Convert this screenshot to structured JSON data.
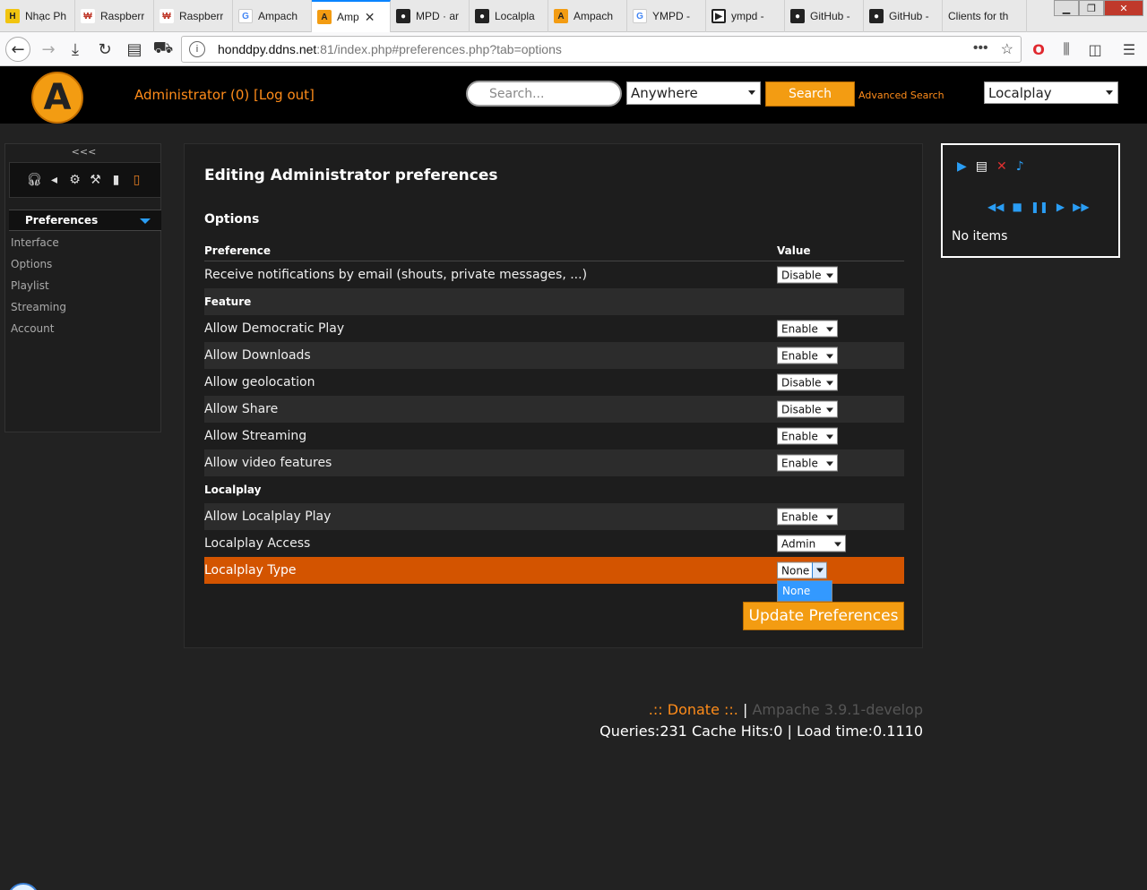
{
  "browser": {
    "tabs": [
      {
        "label": "Nhạc Ph",
        "favicon": "nhac-icon",
        "icon_text": "H"
      },
      {
        "label": "Raspberr",
        "favicon": "raspberry-icon",
        "icon_text": "₩"
      },
      {
        "label": "Raspberr",
        "favicon": "raspberry-icon",
        "icon_text": "₩"
      },
      {
        "label": "Ampach",
        "favicon": "google-icon",
        "icon_text": "G"
      },
      {
        "label": "Amp",
        "favicon": "ampache-icon",
        "icon_text": "A",
        "active": true
      },
      {
        "label": "MPD · ar",
        "favicon": "github-icon",
        "icon_text": "●"
      },
      {
        "label": "Localpla",
        "favicon": "github-icon",
        "icon_text": "●"
      },
      {
        "label": "Ampach",
        "favicon": "ampache-icon",
        "icon_text": "A"
      },
      {
        "label": "YMPD - ",
        "favicon": "google-icon",
        "icon_text": "G"
      },
      {
        "label": "ympd - ",
        "favicon": "ympd-icon",
        "icon_text": "▶"
      },
      {
        "label": "GitHub -",
        "favicon": "github-icon",
        "icon_text": "●"
      },
      {
        "label": "GitHub -",
        "favicon": "github-icon",
        "icon_text": "●"
      },
      {
        "label": "Clients for th",
        "favicon": "",
        "icon_text": ""
      }
    ],
    "url_host": "honddpy.ddns.net",
    "url_rest": ":81/index.php#preferences.php?tab=options"
  },
  "header": {
    "logo_letter": "A",
    "user_text": "Administrator (0) [Log out]",
    "search_placeholder": "Search...",
    "search_scope": "Anywhere",
    "search_button": "Search",
    "advanced_search": "Advanced Search",
    "localplay": "Localplay"
  },
  "sidebar": {
    "collapse_label": "<<<",
    "section": "Preferences",
    "items": [
      "Interface",
      "Options",
      "Playlist",
      "Streaming",
      "Account"
    ]
  },
  "main": {
    "title": "Editing Administrator preferences",
    "section_title": "Options",
    "columns": {
      "preference": "Preference",
      "value": "Value"
    },
    "rows": [
      {
        "type": "pref",
        "label": "Receive notifications by email (shouts, private messages, ...)",
        "value": "Disable",
        "select_width": 68
      },
      {
        "type": "group",
        "label": "Feature"
      },
      {
        "type": "pref",
        "label": "Allow Democratic Play",
        "value": "Enable",
        "select_width": 68
      },
      {
        "type": "pref",
        "label": "Allow Downloads",
        "value": "Enable",
        "select_width": 68
      },
      {
        "type": "pref",
        "label": "Allow geolocation",
        "value": "Disable",
        "select_width": 68
      },
      {
        "type": "pref",
        "label": "Allow Share",
        "value": "Disable",
        "select_width": 68
      },
      {
        "type": "pref",
        "label": "Allow Streaming",
        "value": "Enable",
        "select_width": 68
      },
      {
        "type": "pref",
        "label": "Allow video features",
        "value": "Enable",
        "select_width": 68
      },
      {
        "type": "group",
        "label": "Localplay"
      },
      {
        "type": "pref",
        "label": "Allow Localplay Play",
        "value": "Enable",
        "select_width": 68
      },
      {
        "type": "pref",
        "label": "Localplay Access",
        "value": "Admin",
        "select_width": 77
      },
      {
        "type": "pref",
        "label": "Localplay Type",
        "value": "None",
        "select_width": 56,
        "selected": true,
        "open": true
      }
    ],
    "dropdown_option": "None",
    "update_button": "Update Preferences"
  },
  "player": {
    "empty_text": "No items"
  },
  "footer": {
    "donate": ".:: Donate ::.",
    "separator": "|",
    "version": "Ampache 3.9.1-develop",
    "stats": "Queries:231 Cache Hits:0 | Load time:0.1110"
  },
  "colors": {
    "accent": "#f39c12",
    "link": "#ff8c1a",
    "selected_row": "#d35400",
    "background": "#222222"
  }
}
